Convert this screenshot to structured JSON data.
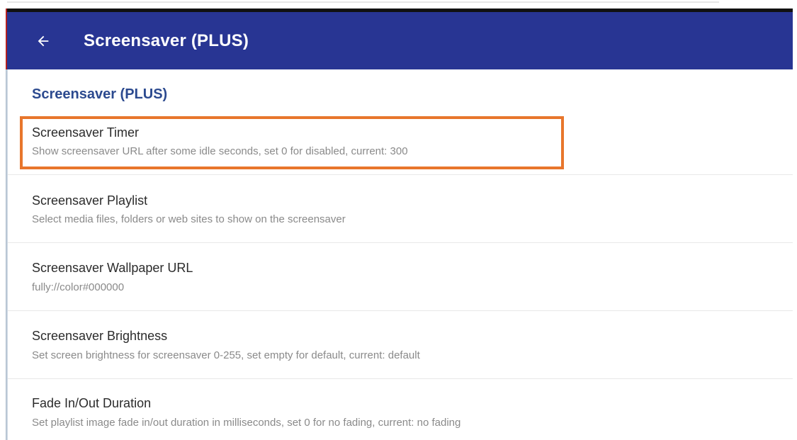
{
  "colors": {
    "appbar": "#283593",
    "accent": "#2c4a8f",
    "highlight": "#e8762c",
    "title_text": "#2b2b2b",
    "summary_text": "#8a8a8a"
  },
  "appbar": {
    "back_icon": "arrow-left-icon",
    "title": "Screensaver (PLUS)"
  },
  "section": {
    "header": "Screensaver (PLUS)"
  },
  "preferences": [
    {
      "title": "Screensaver Timer",
      "summary": "Show screensaver URL after some idle seconds, set 0 for disabled, current: 300"
    },
    {
      "title": "Screensaver Playlist",
      "summary": "Select media files, folders or web sites to show on the screensaver"
    },
    {
      "title": "Screensaver Wallpaper URL",
      "summary": "fully://color#000000"
    },
    {
      "title": "Screensaver Brightness",
      "summary": "Set screen brightness for screensaver 0-255, set empty for default, current: default"
    },
    {
      "title": "Fade In/Out Duration",
      "summary": "Set playlist image fade in/out duration in milliseconds, set 0 for no fading, current: no fading"
    }
  ]
}
